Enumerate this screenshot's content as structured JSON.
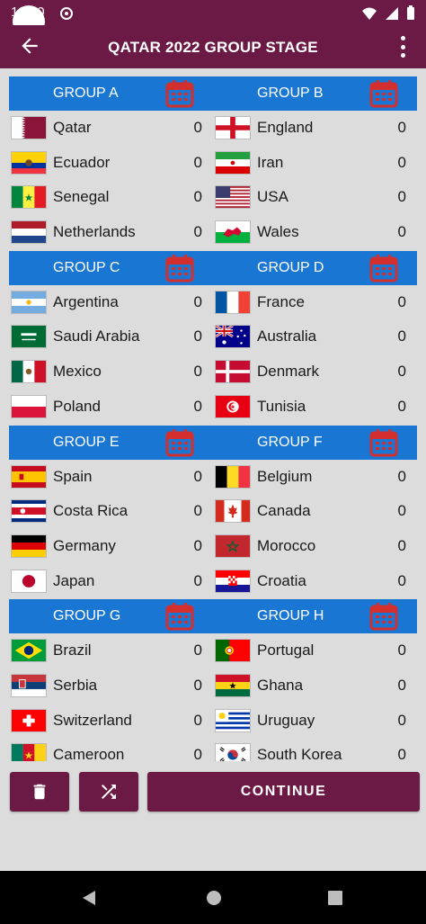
{
  "status": {
    "time": "12:50"
  },
  "appbar": {
    "title": "QATAR 2022 GROUP STAGE"
  },
  "colors": {
    "primary": "#6b1a45",
    "group_header": "#1976d2",
    "calendar": "#d32f2f"
  },
  "groups": [
    {
      "name": "GROUP A",
      "teams": [
        {
          "name": "Qatar",
          "points": "0"
        },
        {
          "name": "Ecuador",
          "points": "0"
        },
        {
          "name": "Senegal",
          "points": "0"
        },
        {
          "name": "Netherlands",
          "points": "0"
        }
      ]
    },
    {
      "name": "GROUP B",
      "teams": [
        {
          "name": "England",
          "points": "0"
        },
        {
          "name": "Iran",
          "points": "0"
        },
        {
          "name": "USA",
          "points": "0"
        },
        {
          "name": "Wales",
          "points": "0"
        }
      ]
    },
    {
      "name": "GROUP C",
      "teams": [
        {
          "name": "Argentina",
          "points": "0"
        },
        {
          "name": "Saudi Arabia",
          "points": "0"
        },
        {
          "name": "Mexico",
          "points": "0"
        },
        {
          "name": "Poland",
          "points": "0"
        }
      ]
    },
    {
      "name": "GROUP D",
      "teams": [
        {
          "name": "France",
          "points": "0"
        },
        {
          "name": "Australia",
          "points": "0"
        },
        {
          "name": "Denmark",
          "points": "0"
        },
        {
          "name": "Tunisia",
          "points": "0"
        }
      ]
    },
    {
      "name": "GROUP E",
      "teams": [
        {
          "name": "Spain",
          "points": "0"
        },
        {
          "name": "Costa Rica",
          "points": "0"
        },
        {
          "name": "Germany",
          "points": "0"
        },
        {
          "name": "Japan",
          "points": "0"
        }
      ]
    },
    {
      "name": "GROUP F",
      "teams": [
        {
          "name": "Belgium",
          "points": "0"
        },
        {
          "name": "Canada",
          "points": "0"
        },
        {
          "name": "Morocco",
          "points": "0"
        },
        {
          "name": "Croatia",
          "points": "0"
        }
      ]
    },
    {
      "name": "GROUP G",
      "teams": [
        {
          "name": "Brazil",
          "points": "0"
        },
        {
          "name": "Serbia",
          "points": "0"
        },
        {
          "name": "Switzerland",
          "points": "0"
        },
        {
          "name": "Cameroon",
          "points": "0"
        }
      ]
    },
    {
      "name": "GROUP H",
      "teams": [
        {
          "name": "Portugal",
          "points": "0"
        },
        {
          "name": "Ghana",
          "points": "0"
        },
        {
          "name": "Uruguay",
          "points": "0"
        },
        {
          "name": "South Korea",
          "points": "0"
        }
      ]
    }
  ],
  "buttons": {
    "delete_icon": "trash-icon",
    "shuffle_icon": "shuffle-icon",
    "continue_label": "CONTINUE"
  }
}
